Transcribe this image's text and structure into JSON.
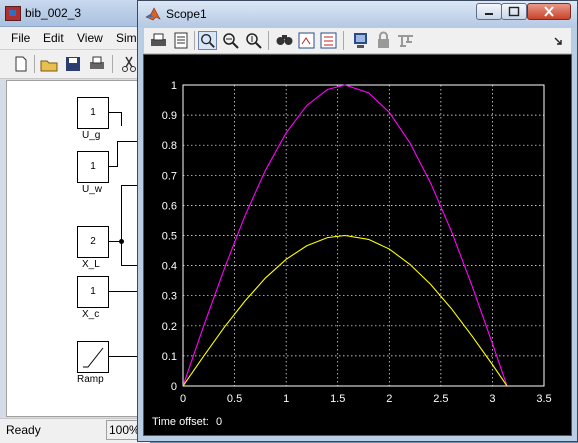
{
  "simulink": {
    "title": "bib_002_3",
    "menu": [
      "File",
      "Edit",
      "View",
      "Sim"
    ],
    "blocks": [
      {
        "value": "1",
        "label": "U_g"
      },
      {
        "value": "1",
        "label": "U_w"
      },
      {
        "value": "2",
        "label": "X_L"
      },
      {
        "value": "1",
        "label": "X_c"
      },
      {
        "value": "",
        "label": "Ramp"
      }
    ],
    "status": "Ready",
    "zoom": "100%"
  },
  "scope": {
    "title": "Scope1",
    "time_offset_label": "Time offset:",
    "time_offset_value": "0",
    "toolbar_icons": [
      "print-icon",
      "parameters-icon",
      "zoom-icon",
      "zoom-x-icon",
      "zoom-y-icon",
      "autoscale-icon",
      "save-axes-icon",
      "restore-axes-icon",
      "floating-scope-icon",
      "lock-icon",
      "signal-selection-icon"
    ]
  },
  "chart_data": {
    "type": "line",
    "xlim": [
      0,
      3.5
    ],
    "ylim": [
      0,
      1
    ],
    "x_ticks": [
      "0",
      "0.5",
      "1",
      "1.5",
      "2",
      "2.5",
      "3",
      "3.5"
    ],
    "y_ticks": [
      "0",
      "0.1",
      "0.2",
      "0.3",
      "0.4",
      "0.5",
      "0.6",
      "0.7",
      "0.8",
      "0.9",
      "1"
    ],
    "grid": true,
    "background": "#000000",
    "series": [
      {
        "color": "#ff00ff",
        "x": [
          0,
          0.2,
          0.4,
          0.6,
          0.8,
          1.0,
          1.2,
          1.4,
          1.5708,
          1.8,
          2.0,
          2.2,
          2.4,
          2.6,
          2.8,
          3.0,
          3.1416
        ],
        "y": [
          0,
          0.199,
          0.389,
          0.565,
          0.717,
          0.841,
          0.932,
          0.985,
          1.0,
          0.974,
          0.909,
          0.808,
          0.675,
          0.516,
          0.335,
          0.141,
          0
        ]
      },
      {
        "color": "#ffff00",
        "x": [
          0,
          0.2,
          0.4,
          0.6,
          0.8,
          1.0,
          1.2,
          1.4,
          1.5708,
          1.8,
          2.0,
          2.2,
          2.4,
          2.6,
          2.8,
          3.0,
          3.1416
        ],
        "y": [
          0,
          0.099,
          0.195,
          0.282,
          0.359,
          0.421,
          0.466,
          0.493,
          0.5,
          0.487,
          0.455,
          0.404,
          0.338,
          0.258,
          0.167,
          0.071,
          0
        ]
      }
    ]
  }
}
